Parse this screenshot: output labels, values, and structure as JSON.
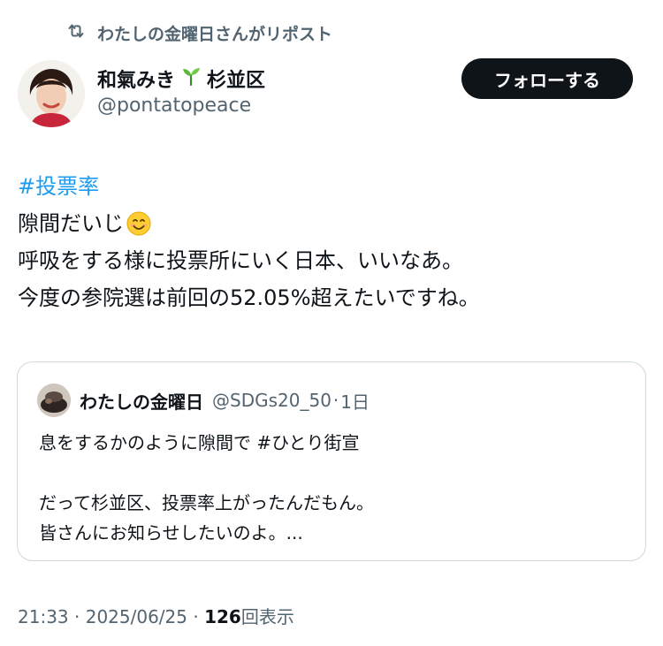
{
  "repost": {
    "icon": "repost-icon",
    "text": "わたしの金曜日さんがリポスト"
  },
  "author": {
    "name": "和氣みき",
    "name_suffix": "杉並区",
    "emoji": "seedling-icon",
    "handle": "@pontatopeace",
    "avatar": "avatar"
  },
  "follow_button": {
    "label": "フォローする"
  },
  "tweet": {
    "hashtag": "#投票率",
    "line2": "隙間だいじ",
    "line2_emoji": "smiling-face-icon",
    "line3": "呼吸をする様に投票所にいく日本、いいなあ。",
    "line4": "今度の参院選は前回の52.05%超えたいですね。"
  },
  "quote": {
    "name": "わたしの金曜日",
    "handle": "@SDGs20_50",
    "separator": "·",
    "time": "1日",
    "line1": "息をするかのように隙間で #ひとり街宣",
    "line2": "だって杉並区、投票率上がったんだもん。",
    "line3": "皆さんにお知らせしたいのよ。..."
  },
  "meta": {
    "time": "21:33",
    "sep1": "·",
    "date": "2025/06/25",
    "sep2": "·",
    "views_count": "126",
    "views_label": "回表示"
  },
  "colors": {
    "link": "#1d9bf0",
    "secondary_text": "#536471",
    "primary_text": "#0f1419",
    "button_bg": "#0f1419",
    "border": "#cfd9de"
  }
}
